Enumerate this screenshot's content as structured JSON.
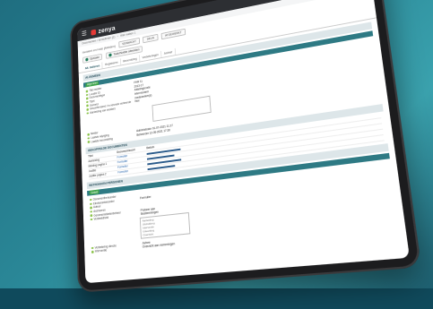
{
  "app": {
    "name": "zenya"
  },
  "breadcrumb": [
    "Documenten / formulieren (1)",
    "Wat maken 1"
  ],
  "header": {
    "title": "Incident en Huis (Melden)",
    "status": [
      "VERWACHT",
      "DELIN",
      "AFGEWERKT"
    ]
  },
  "actions": [
    {
      "label": "Opslaan"
    },
    {
      "label": "Taak/Notitie afmelden"
    }
  ],
  "tabs": [
    "Alt. indienen",
    "Registreren",
    "Beoordeling",
    "Verbeteringen",
    "Archief"
  ],
  "sections": {
    "registratie": {
      "title": "ALGEMEEN",
      "badge": "Algemeen",
      "fields": [
        {
          "label": "Titel melder",
          "value": "FHR 11"
        },
        {
          "label": "Locatie ID",
          "value": "2013-17"
        },
        {
          "label": "Documenttype",
          "value": "Afdelingscode"
        },
        {
          "label": "Type",
          "value": "Intern/extern"
        },
        {
          "label": "Gemeld",
          "value": "medewerker(s)"
        },
        {
          "label": "Geconfirmeerd / in verzoek verleende",
          "value": "Nee"
        },
        {
          "label": "Aanleiding van melders",
          "value": ""
        }
      ],
      "extra_fields": [
        {
          "label": "Melder"
        },
        {
          "label": "Laatste wijziging",
          "value": "Administrator 01-07-2021 11:17"
        },
        {
          "label": "Laatste beoordeling",
          "value": "Beheerder 12-05-2021 17:30"
        }
      ]
    },
    "documents": {
      "title": "GEKOPPELDE DOCUMENTEN",
      "columns": [
        "Titel",
        "Documentsoort",
        "Datum"
      ],
      "rows": [
        {
          "name": "Aanleiding",
          "link": "Formulier",
          "date": ""
        },
        {
          "name": "Melding pagina 1",
          "link": "Formulier",
          "date": ""
        },
        {
          "name": "Justitie",
          "link": "Formulier",
          "date": ""
        },
        {
          "name": "Justitie pagina 2",
          "link": "Formulier",
          "date": ""
        }
      ]
    },
    "actions_list": {
      "title": "BETROKKEN PERSONEN",
      "badge": "Geleid",
      "fields": [
        {
          "label": "Documentbeheerder",
          "value": ""
        },
        {
          "label": "Eindverantwoorder",
          "value": "Formulier"
        },
        {
          "label": "Auteur",
          "value": ""
        },
        {
          "label": "Archiveren",
          "value": ""
        },
        {
          "label": "Geneesmiddelenbeheer",
          "value": "Probeer aan"
        },
        {
          "label": "Verdeeldheid",
          "value": "Bestemmingen"
        }
      ]
    },
    "footer_fields": [
      {
        "label": "Verbetering directe",
        "value": "Ja/nee"
      },
      {
        "label": "Interventie",
        "value": "Overzicht aan nemeningen"
      }
    ],
    "list_items": [
      "Aanleiding",
      "Uitdrukking",
      "Interventie",
      "Uitwerking",
      "Overzicht"
    ]
  }
}
